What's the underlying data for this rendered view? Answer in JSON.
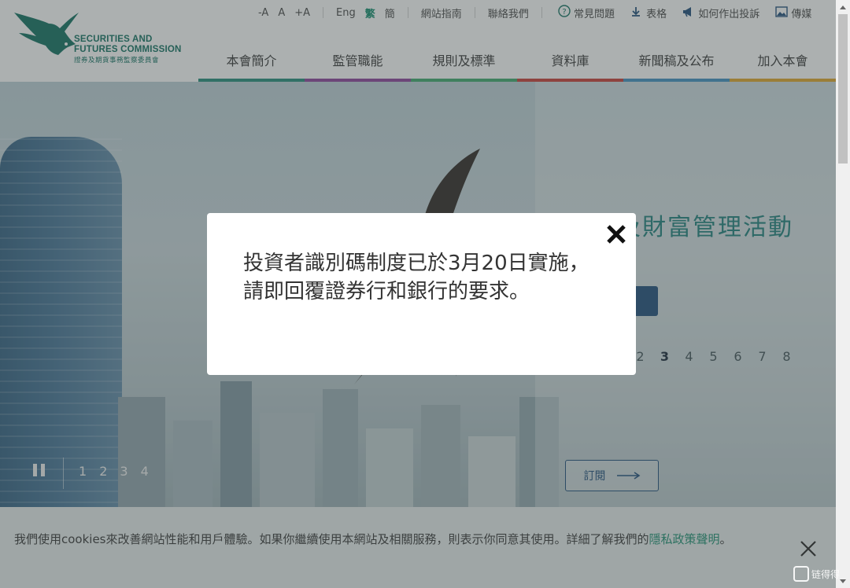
{
  "logo": {
    "line1": "SECURITIES AND",
    "line2": "FUTURES COMMISSION",
    "line3": "證券及期貨事務監察委員會"
  },
  "utility": {
    "font_small": "-A",
    "font_normal": "A",
    "font_large": "+A",
    "lang_en": "Eng",
    "lang_tc": "繁",
    "lang_sc": "簡",
    "sitemap": "網站指南",
    "contact": "聯絡我們",
    "faq": "常見問題",
    "forms": "表格",
    "complaint": "如何作出投訴",
    "media": "傳媒"
  },
  "nav": [
    {
      "label": "本會簡介",
      "color": "#1f8a78"
    },
    {
      "label": "監管職能",
      "color": "#8a3f9a"
    },
    {
      "label": "規則及標準",
      "color": "#3aa86a"
    },
    {
      "label": "資料庫",
      "color": "#c83a32"
    },
    {
      "label": "新聞稿及公布",
      "color": "#3c8fc2"
    },
    {
      "label": "加入本會",
      "color": "#e1a526"
    }
  ],
  "hero": {
    "title": "資產及財富管理活動",
    "right_pages": [
      "2",
      "3",
      "4",
      "5",
      "6",
      "7",
      "8"
    ],
    "left_pages": [
      "1",
      "2",
      "3",
      "4"
    ],
    "subscribe": "訂閱"
  },
  "modal": {
    "message": "投資者識別碼制度已於3月20日實施，請即回覆證券行和銀行的要求。"
  },
  "cookie": {
    "text": "我們使用cookies來改善網站性能和用戶體驗。如果你繼續使用本網站及相關服務，則表示你同意其使用。詳細了解我們的",
    "link": "隱私政策聲明",
    "end": "。"
  },
  "watermark": {
    "text": "链得得"
  },
  "colors": {
    "brand": "#0b6e5e",
    "accent": "#1a8f70",
    "navy": "#1b4a78"
  }
}
